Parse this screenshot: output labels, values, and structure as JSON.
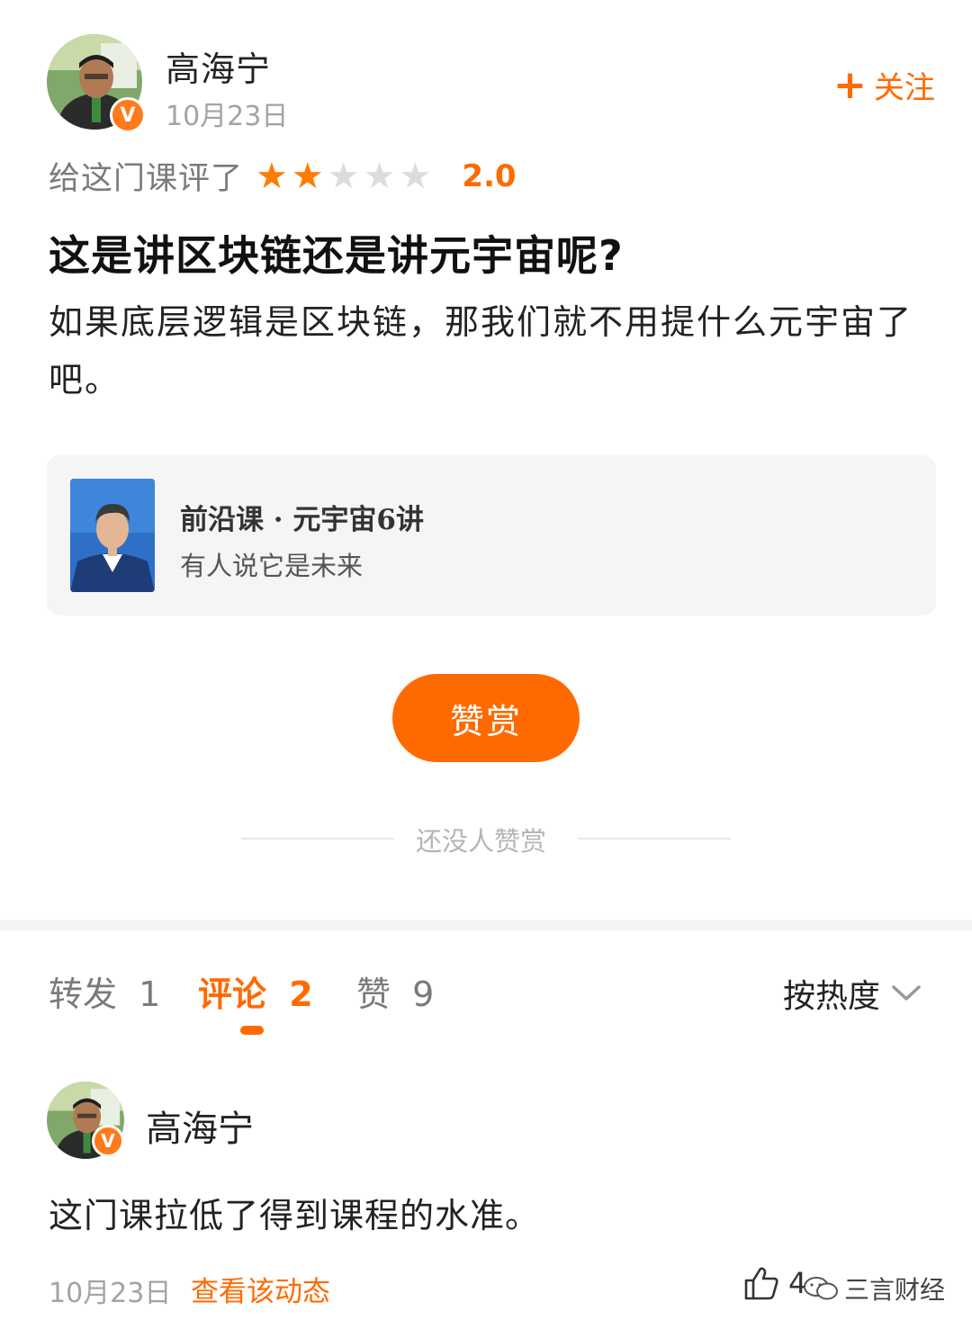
{
  "post": {
    "author": "高海宁",
    "date": "10月23日",
    "follow_label": "关注",
    "rating_label": "给这门课评了",
    "rating_stars": 2,
    "rating_max": 5,
    "rating_score": "2.0",
    "title": "这是讲区块链还是讲元宇宙呢?",
    "body": "如果底层逻辑是区块链，那我们就不用提什么元宇宙了吧。"
  },
  "course": {
    "title": "前沿课 · 元宇宙6讲",
    "subtitle": "有人说它是未来"
  },
  "reward": {
    "button_label": "赞赏",
    "empty_text": "还没人赞赏"
  },
  "tabs": [
    {
      "label": "转发",
      "count": "1"
    },
    {
      "label": "评论",
      "count": "2"
    },
    {
      "label": "赞",
      "count": "9"
    }
  ],
  "sort_label": "按热度",
  "comment": {
    "author": "高海宁",
    "text": "这门课拉低了得到课程的水准。",
    "date": "10月23日",
    "view_link": "查看该动态",
    "like_count": "4"
  },
  "watermark": "三言财经",
  "colors": {
    "accent": "#ff6a00",
    "star_off": "#dcdcdc",
    "muted_text": "#a3a3a3"
  }
}
